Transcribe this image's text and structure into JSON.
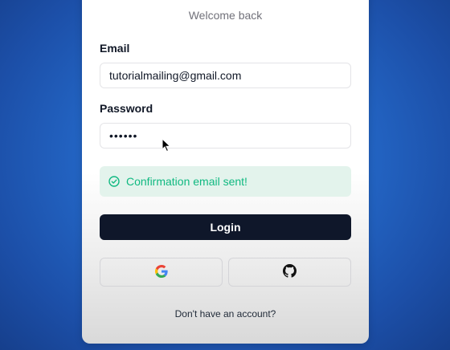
{
  "login_form": {
    "subtitle": "Welcome back",
    "email_label": "Email",
    "email_value": "tutorialmailing@gmail.com",
    "password_label": "Password",
    "password_value": "••••••",
    "alert_message": "Confirmation email sent!",
    "login_button_label": "Login",
    "footer_text": "Don't have an account?"
  },
  "icons": {
    "alert": "check-circle-icon",
    "google": "google-icon",
    "github": "github-icon",
    "cursor": "mouse-pointer-icon"
  },
  "colors": {
    "alert_text": "#10b981",
    "alert_bg": "#e3f3ec",
    "primary_button": "#0f172a",
    "background": "#2468c8"
  }
}
